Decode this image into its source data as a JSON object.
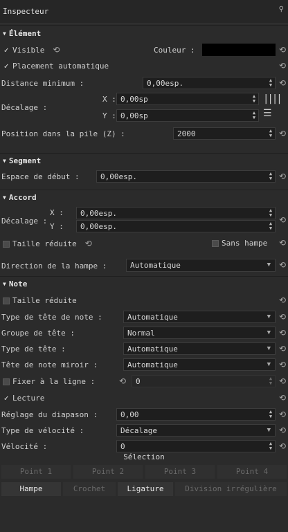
{
  "title": "Inspecteur",
  "pin_icon": "pin-icon",
  "element": {
    "header": "Élément",
    "visible_label": "Visible",
    "color_label": "Couleur :",
    "color_value": "#000000",
    "auto_place_label": "Placement automatique",
    "min_distance_label": "Distance minimum :",
    "min_distance_value": "0,00esp.",
    "offset_label": "Décalage :",
    "offset_x_label": "X :",
    "offset_x_value": "0,00sp",
    "offset_y_label": "Y :",
    "offset_y_value": "0,00sp",
    "stack_label": "Position dans la pile (Z) :",
    "stack_value": "2000"
  },
  "segment": {
    "header": "Segment",
    "start_space_label": "Espace de début :",
    "start_space_value": "0,00esp."
  },
  "chord": {
    "header": "Accord",
    "offset_label": "Décalage :",
    "x_label": "X :",
    "x_value": "0,00esp.",
    "y_label": "Y :",
    "y_value": "0,00esp.",
    "small_label": "Taille réduite",
    "no_stem_label": "Sans hampe",
    "stem_dir_label": "Direction de la hampe :",
    "stem_dir_value": "Automatique"
  },
  "note": {
    "header": "Note",
    "small_label": "Taille réduite",
    "head_type_label": "Type de tête de note :",
    "head_type_value": "Automatique",
    "head_group_label": "Groupe de tête :",
    "head_group_value": "Normal",
    "head_kind_label": "Type de tête :",
    "head_kind_value": "Automatique",
    "mirror_label": "Tête de note miroir :",
    "mirror_value": "Automatique",
    "fix_line_label": "Fixer à la ligne :",
    "fix_line_value": "0",
    "play_label": "Lecture",
    "tuning_label": "Réglage du diapason :",
    "tuning_value": "0,00",
    "velocity_type_label": "Type de vélocité :",
    "velocity_type_value": "Décalage",
    "velocity_label": "Vélocité :",
    "velocity_value": "0"
  },
  "selection": {
    "header": "Sélection",
    "points": [
      "Point 1",
      "Point 2",
      "Point 3",
      "Point 4"
    ],
    "tabs": [
      "Hampe",
      "Crochet",
      "Ligature",
      "Division irrégulière"
    ]
  }
}
